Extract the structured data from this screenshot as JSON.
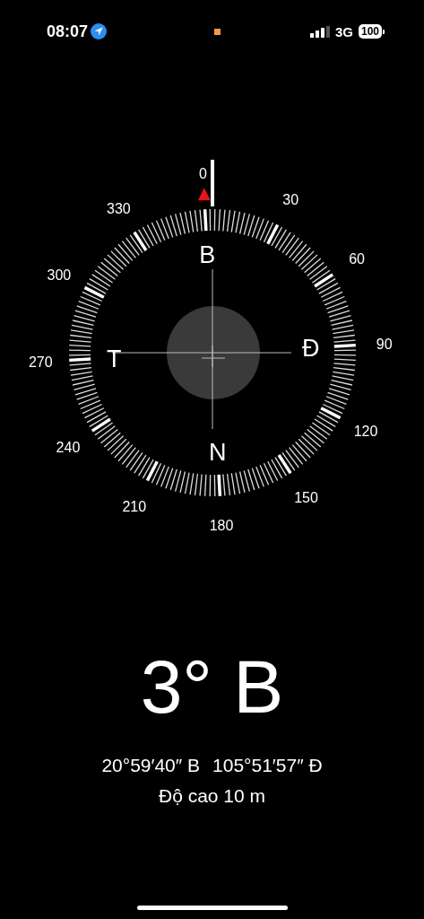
{
  "status_bar": {
    "time": "08:07",
    "network": "3G",
    "battery": "100"
  },
  "dial": {
    "numbers": [
      "0",
      "30",
      "60",
      "90",
      "120",
      "150",
      "180",
      "210",
      "240",
      "270",
      "300",
      "330"
    ],
    "cardinals": [
      "B",
      "Đ",
      "N",
      "T"
    ]
  },
  "heading": "3° B",
  "coordinates": {
    "latitude": "20°59′40″ B",
    "longitude": "105°51′57″ Đ"
  },
  "altitude": "Độ cao 10 m"
}
